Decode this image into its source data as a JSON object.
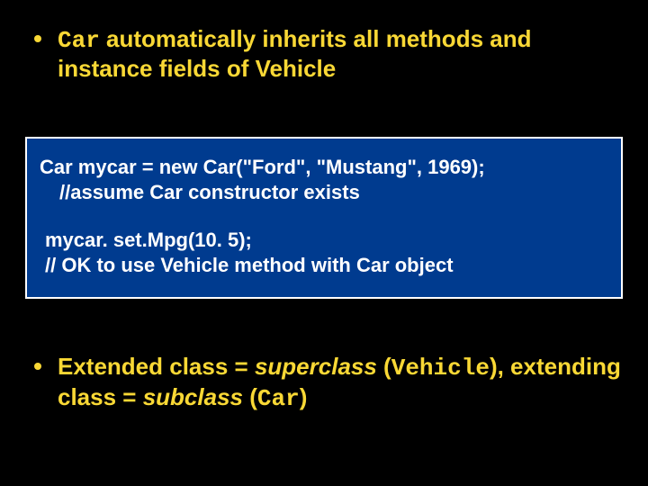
{
  "bullet1": {
    "part_mono": "Car",
    "part_rest": " automatically inherits all methods and instance fields of Vehicle"
  },
  "code": {
    "l1": "Car mycar  = new Car(\"Ford\", \"Mustang\", 1969);",
    "l2": "//assume Car constructor exists",
    "l3": "mycar. set.Mpg(10. 5);",
    "l4": "// OK to use Vehicle method with Car object"
  },
  "bullet2": {
    "p1": "Extended class = ",
    "em1": "superclass",
    "p2": " (",
    "mono1": "Vehicle",
    "p3": "), extending class = ",
    "em2": "subclass",
    "p4": " (",
    "mono2": "Car",
    "p5": ")"
  }
}
